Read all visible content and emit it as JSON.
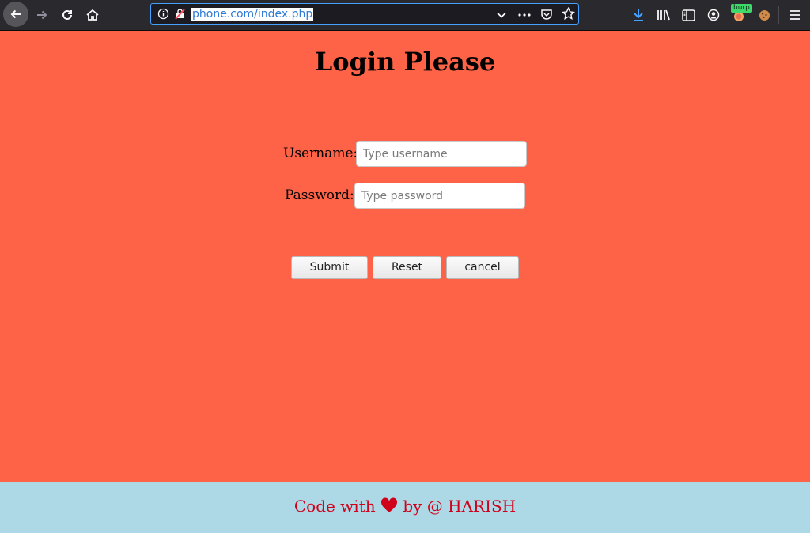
{
  "browser": {
    "url": "phone.com/index.php",
    "extension_badge": "burp"
  },
  "page": {
    "title": "Login Please",
    "username_label": "Username:",
    "username_placeholder": "Type username",
    "password_label": "Password:",
    "password_placeholder": "Type password",
    "submit_label": "Submit",
    "reset_label": "Reset",
    "cancel_label": "cancel"
  },
  "footer": {
    "prefix": "Code with",
    "suffix": "by @ HARISH",
    "heart_icon": "heart-icon",
    "heart_color": "#d0021b"
  },
  "colors": {
    "page_background": "#ff6347",
    "footer_background": "#add8e6"
  }
}
